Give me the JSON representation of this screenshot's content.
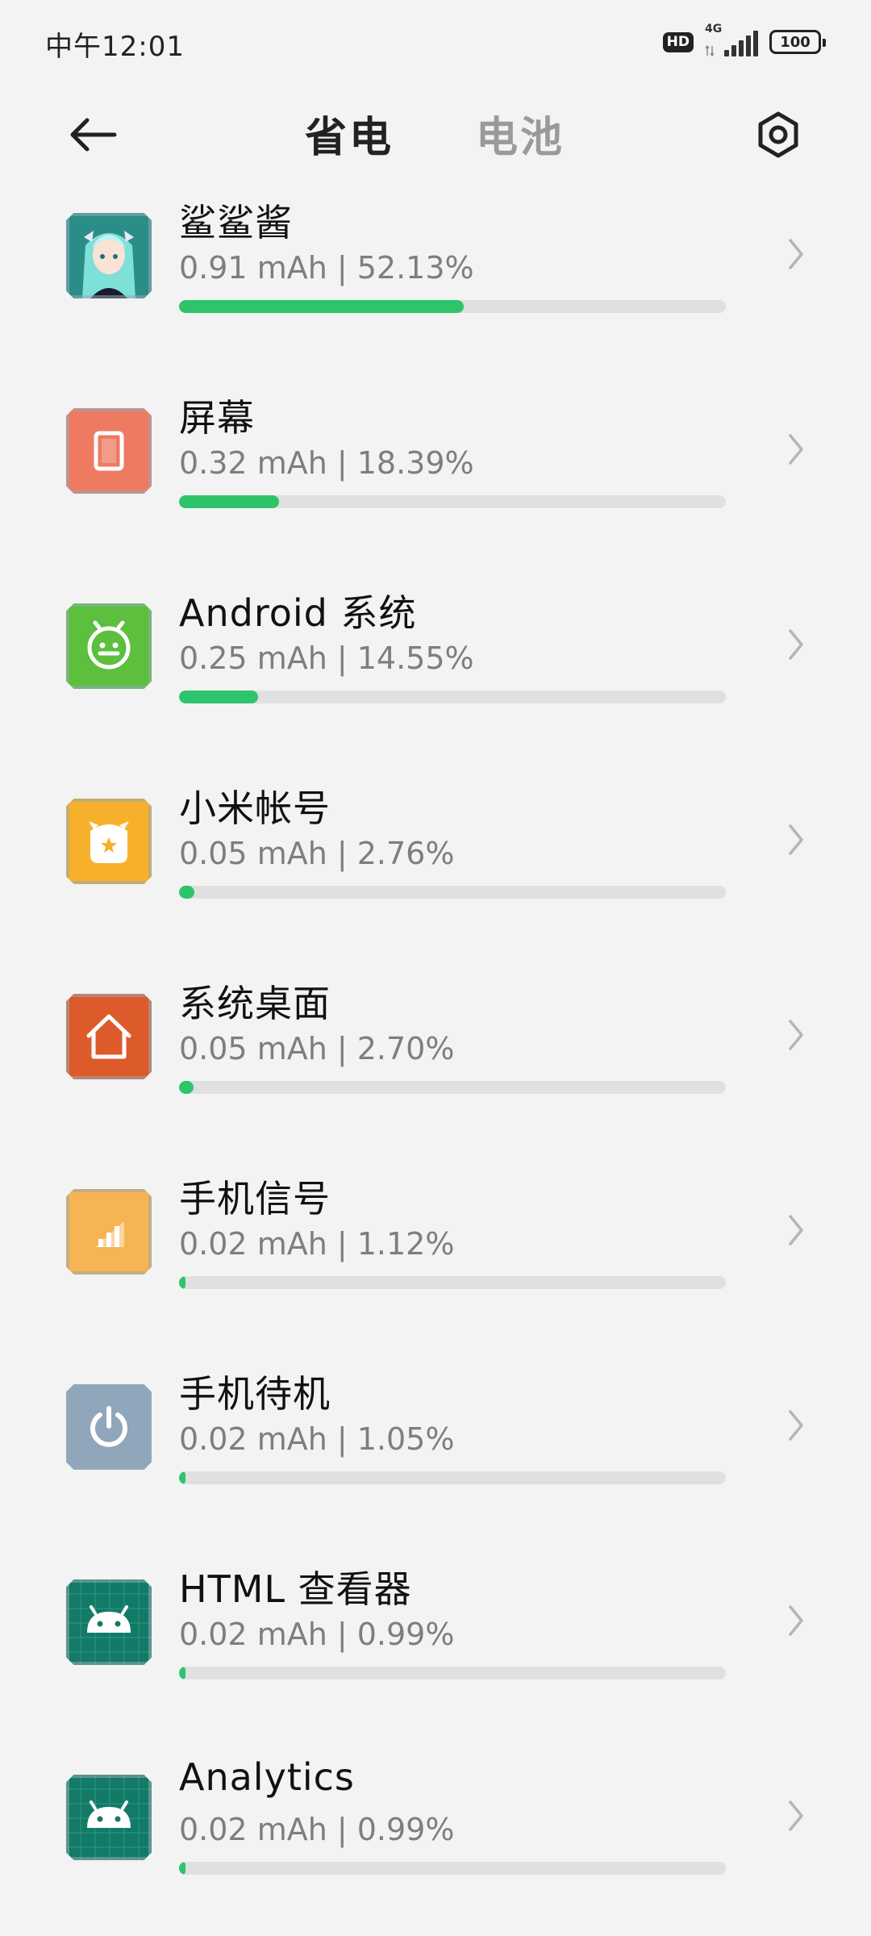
{
  "status_bar": {
    "time": "中午12:01",
    "hd_label": "HD",
    "network_label": "4G",
    "battery_label": "100"
  },
  "header": {
    "tabs": [
      {
        "label": "省电",
        "active": true
      },
      {
        "label": "电池",
        "active": false
      }
    ],
    "icons": {
      "back": "back-arrow-icon",
      "settings": "settings-icon"
    }
  },
  "colors": {
    "progress_fill": "#2ec46b",
    "progress_track": "#e0e0e0",
    "background": "#f3f3f3"
  },
  "apps": [
    {
      "name": "鲨鲨酱",
      "usage": "0.91 mAh | 52.13%",
      "percent": 52.13,
      "icon": "anime-avatar-icon",
      "icon_color": "#1e7f7a"
    },
    {
      "name": "屏幕",
      "usage": "0.32 mAh | 18.39%",
      "percent": 18.39,
      "icon": "screen-icon",
      "icon_color": "#ee7a62"
    },
    {
      "name": "Android 系统",
      "usage": "0.25 mAh | 14.55%",
      "percent": 14.55,
      "icon": "android-face-icon",
      "icon_color": "#5cbf3d"
    },
    {
      "name": "小米帐号",
      "usage": "0.05 mAh | 2.76%",
      "percent": 2.76,
      "icon": "mi-account-icon",
      "icon_color": "#f7b02c"
    },
    {
      "name": "系统桌面",
      "usage": "0.05 mAh | 2.70%",
      "percent": 2.7,
      "icon": "home-icon",
      "icon_color": "#dd5b2b"
    },
    {
      "name": "手机信号",
      "usage": "0.02 mAh | 1.12%",
      "percent": 1.12,
      "icon": "signal-icon",
      "icon_color": "#f6b453"
    },
    {
      "name": "手机待机",
      "usage": "0.02 mAh | 1.05%",
      "percent": 1.05,
      "icon": "power-icon",
      "icon_color": "#8fa6bb"
    },
    {
      "name": "HTML 查看器",
      "usage": "0.02 mAh | 0.99%",
      "percent": 0.99,
      "icon": "android-robot-icon",
      "icon_color": "#137a67"
    },
    {
      "name": "Analytics",
      "usage": "0.02 mAh | 0.99%",
      "percent": 0.99,
      "icon": "android-robot-icon",
      "icon_color": "#137a67"
    }
  ]
}
